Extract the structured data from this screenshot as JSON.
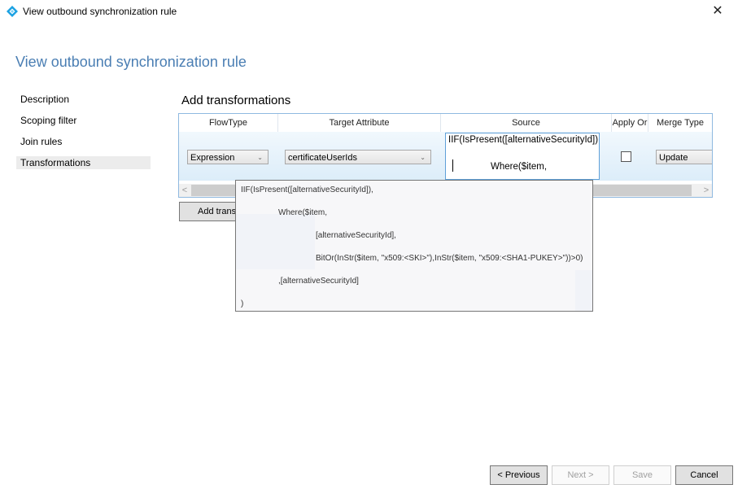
{
  "window": {
    "title": "View outbound synchronization rule",
    "icon": "azure-ad-connect-diamond-icon",
    "close_icon": "close-icon",
    "close_glyph": "✕"
  },
  "page": {
    "title": "View outbound synchronization rule"
  },
  "sidebar": {
    "items": [
      {
        "label": "Description",
        "active": false
      },
      {
        "label": "Scoping filter",
        "active": false
      },
      {
        "label": "Join rules",
        "active": false
      },
      {
        "label": "Transformations",
        "active": true
      }
    ]
  },
  "transformations": {
    "title": "Add transformations",
    "columns": [
      "FlowType",
      "Target Attribute",
      "Source",
      "Apply Or",
      "Merge Type"
    ],
    "rows": [
      {
        "flow_type": "Expression",
        "target_attribute": "certificateUserIds",
        "source_line1": "IIF(IsPresent([alternativeSecurityId])",
        "source_line2": "Where($item,",
        "apply_once": false,
        "merge_type": "Update"
      }
    ],
    "chevron_glyph": "⌄",
    "scroll_left_glyph": "<",
    "scroll_right_glyph": ">",
    "add_button_label": "Add transformation"
  },
  "tooltip": {
    "lines": [
      "IIF(IsPresent([alternativeSecurityId]),",
      "Where($item,",
      "[alternativeSecurityId],",
      "BitOr(InStr($item, \"x509:<SKI>\"),InStr($item, \"x509:<SHA1-PUKEY>\"))>0)",
      ",[alternativeSecurityId]",
      ")"
    ]
  },
  "footer": {
    "previous_label": "< Previous",
    "next_label": "Next >",
    "save_label": "Save",
    "cancel_label": "Cancel",
    "next_enabled": false,
    "save_enabled": false
  },
  "colors": {
    "accent": "#4a7eb3",
    "grid_border": "#8fb9e0",
    "icon_blue": "#1ba1e2"
  }
}
